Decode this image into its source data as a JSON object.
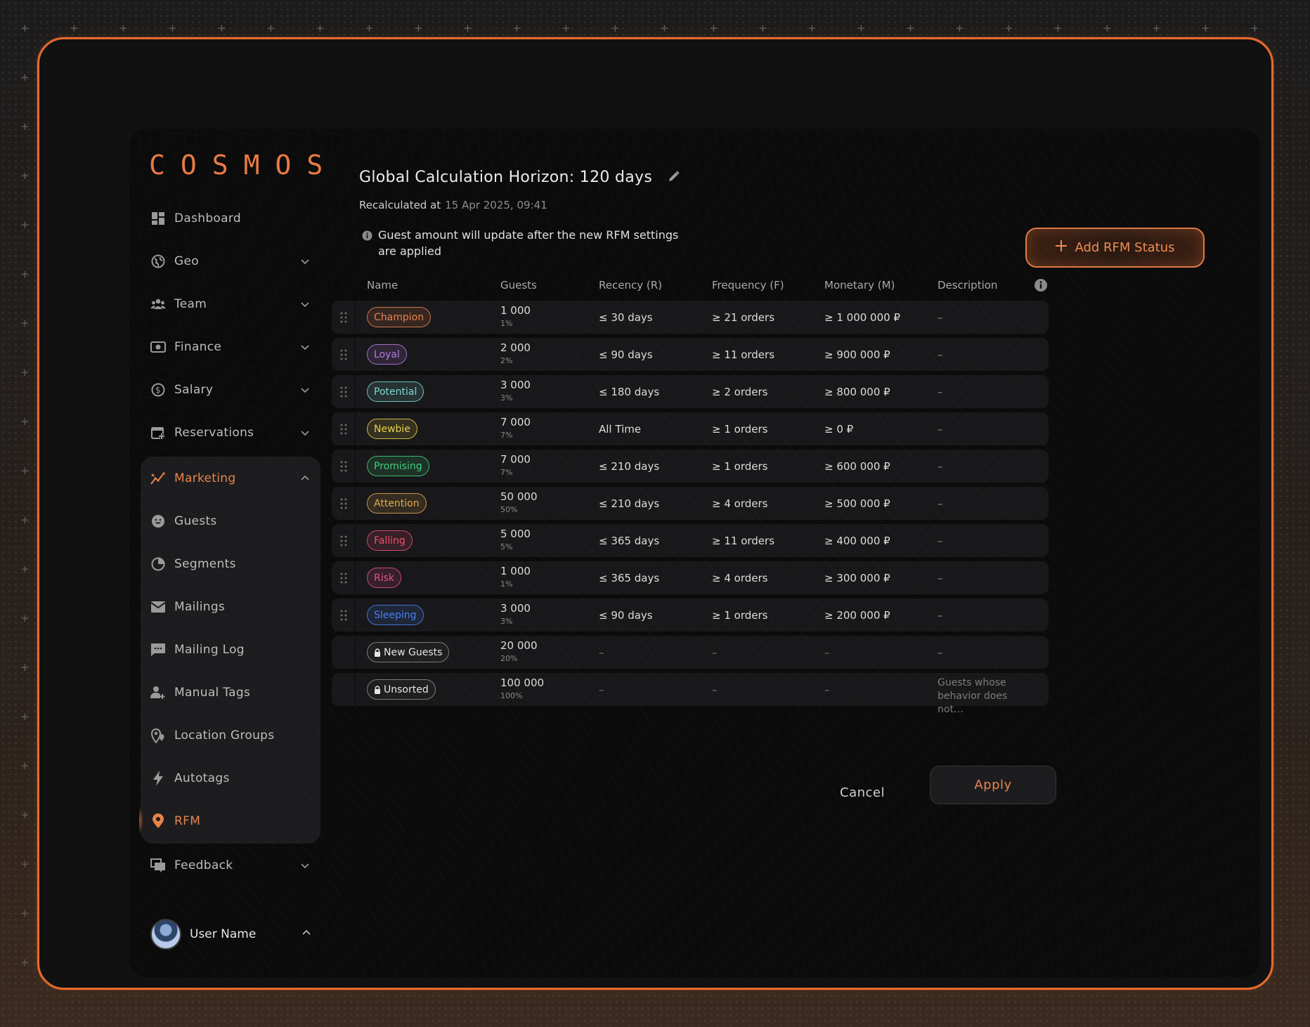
{
  "app": {
    "logo": "COSMOS"
  },
  "sidebar": {
    "items": [
      {
        "label": "Dashboard",
        "icon": "dashboard-icon",
        "chevron": false
      },
      {
        "label": "Geo",
        "icon": "globe-icon",
        "chevron": true
      },
      {
        "label": "Team",
        "icon": "team-icon",
        "chevron": true
      },
      {
        "label": "Finance",
        "icon": "money-icon",
        "chevron": true
      },
      {
        "label": "Salary",
        "icon": "dollar-icon",
        "chevron": true
      },
      {
        "label": "Reservations",
        "icon": "calendar-add-icon",
        "chevron": true
      }
    ],
    "marketing": {
      "label": "Marketing",
      "icon": "chart-line-icon",
      "expanded": true,
      "children": [
        {
          "label": "Guests",
          "icon": "smile-icon"
        },
        {
          "label": "Segments",
          "icon": "pie-icon"
        },
        {
          "label": "Mailings",
          "icon": "mail-icon"
        },
        {
          "label": "Mailing Log",
          "icon": "chat-icon"
        },
        {
          "label": "Manual Tags",
          "icon": "user-tag-icon"
        },
        {
          "label": "Location Groups",
          "icon": "location-pins-icon"
        },
        {
          "label": "Autotags",
          "icon": "bolt-icon"
        },
        {
          "label": "RFM",
          "icon": "rfm-pin-icon",
          "active": true
        }
      ]
    },
    "after": [
      {
        "label": "Feedback",
        "icon": "feedback-icon",
        "chevron": true
      }
    ],
    "user": {
      "name": "User Name"
    }
  },
  "header": {
    "title": "Global Calculation Horizon:  120 days",
    "recalculated_label": "Recalculated at",
    "recalculated_value": "15 Apr 2025, 09:41",
    "notice": "Guest amount will update after the new RFM settings are applied",
    "add_button": "Add RFM Status"
  },
  "table": {
    "columns": [
      "Name",
      "Guests",
      "Recency (R)",
      "Frequency (F)",
      "Monetary (M)",
      "Description"
    ],
    "rows": [
      {
        "name": "Champion",
        "color": "#e8834d",
        "guests": "1 000",
        "pct": "1%",
        "recency": "≤ 30 days",
        "frequency": "≥ 21 orders",
        "monetary": "≥ 1 000 000 ₽",
        "description": "–",
        "draggable": true,
        "locked": false
      },
      {
        "name": "Loyal",
        "color": "#b57be0",
        "guests": "2 000",
        "pct": "2%",
        "recency": "≤ 90 days",
        "frequency": "≥ 11 orders",
        "monetary": "≥ 900 000 ₽",
        "description": "–",
        "draggable": true,
        "locked": false
      },
      {
        "name": "Potential",
        "color": "#7fd6d0",
        "guests": "3 000",
        "pct": "3%",
        "recency": "≤ 180 days",
        "frequency": "≥ 2 orders",
        "monetary": "≥ 800 000 ₽",
        "description": "–",
        "draggable": true,
        "locked": false
      },
      {
        "name": "Newbie",
        "color": "#e8d04a",
        "guests": "7 000",
        "pct": "7%",
        "recency": "All Time",
        "frequency": "≥ 1 orders",
        "monetary": "≥ 0 ₽",
        "description": "–",
        "draggable": true,
        "locked": false
      },
      {
        "name": "Promising",
        "color": "#3fce7a",
        "guests": "7 000",
        "pct": "7%",
        "recency": "≤ 210 days",
        "frequency": "≥ 1 orders",
        "monetary": "≥ 600 000 ₽",
        "description": "–",
        "draggable": true,
        "locked": false
      },
      {
        "name": "Attention",
        "color": "#e3a84a",
        "guests": "50 000",
        "pct": "50%",
        "recency": "≤ 210 days",
        "frequency": "≥ 4 orders",
        "monetary": "≥ 500 000 ₽",
        "description": "–",
        "draggable": true,
        "locked": false
      },
      {
        "name": "Falling",
        "color": "#f0506e",
        "guests": "5 000",
        "pct": "5%",
        "recency": "≤ 365 days",
        "frequency": "≥ 11 orders",
        "monetary": "≥ 400 000 ₽",
        "description": "–",
        "draggable": true,
        "locked": false
      },
      {
        "name": "Risk",
        "color": "#e8508a",
        "guests": "1 000",
        "pct": "1%",
        "recency": "≤ 365 days",
        "frequency": "≥ 4 orders",
        "monetary": "≥ 300 000 ₽",
        "description": "–",
        "draggable": true,
        "locked": false
      },
      {
        "name": "Sleeping",
        "color": "#4a7ff0",
        "guests": "3 000",
        "pct": "3%",
        "recency": "≤ 90 days",
        "frequency": "≥ 1 orders",
        "monetary": "≥ 200 000 ₽",
        "description": "–",
        "draggable": true,
        "locked": false
      },
      {
        "name": "New Guests",
        "color": "#d86a4a",
        "guests": "20 000",
        "pct": "20%",
        "recency": "–",
        "frequency": "–",
        "monetary": "–",
        "description": "–",
        "draggable": false,
        "locked": true
      },
      {
        "name": "Unsorted",
        "color": "#c8c8c8",
        "guests": "100 000",
        "pct": "100%",
        "recency": "–",
        "frequency": "–",
        "monetary": "–",
        "description": "Guests whose behavior does not…",
        "draggable": false,
        "locked": true
      }
    ]
  },
  "footer": {
    "cancel": "Cancel",
    "apply": "Apply"
  },
  "colors": {
    "accent": "#e8834d",
    "frame": "#e56a2c",
    "panel": "#0b0b0b"
  }
}
